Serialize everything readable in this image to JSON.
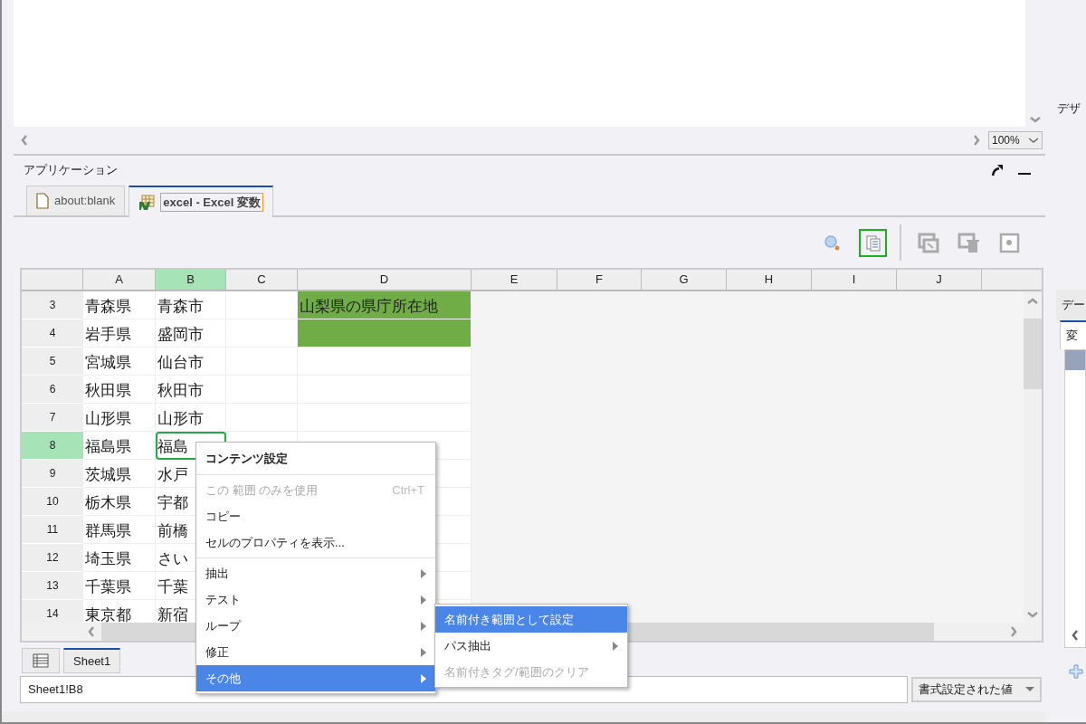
{
  "preview": {
    "zoom": "100%"
  },
  "side_panel": {
    "title": "デザ",
    "tab_header": "デー",
    "tab": "変"
  },
  "panel": {
    "title": "アプリケーション"
  },
  "tabs": [
    {
      "label": "about:blank",
      "kind": "page",
      "selected": false
    },
    {
      "label": "excel - Excel 変数",
      "kind": "sheet",
      "selected": true
    }
  ],
  "toolbar": [
    {
      "kind": "search",
      "on": false,
      "disabled": false
    },
    {
      "kind": "document",
      "on": true,
      "disabled": false
    },
    {
      "kind": "window-arrow",
      "on": false,
      "disabled": true
    },
    {
      "kind": "window-trash",
      "on": false,
      "disabled": true
    },
    {
      "kind": "window-search",
      "on": false,
      "disabled": true
    }
  ],
  "sheet": {
    "columns": [
      {
        "label": "A",
        "selected": false
      },
      {
        "label": "B",
        "selected": true
      },
      {
        "label": "C",
        "selected": false
      },
      {
        "label": "D",
        "selected": false
      },
      {
        "label": "E",
        "selected": false
      },
      {
        "label": "F",
        "selected": false
      },
      {
        "label": "G",
        "selected": false
      },
      {
        "label": "H",
        "selected": false
      },
      {
        "label": "I",
        "selected": false
      },
      {
        "label": "J",
        "selected": false
      }
    ],
    "rows": [
      {
        "number": "3",
        "selected": false,
        "a": "青森県",
        "b": "青森市",
        "d": "山梨県の県庁所在地",
        "d_filled": true
      },
      {
        "number": "4",
        "selected": false,
        "a": "岩手県",
        "b": "盛岡市",
        "d_filled": true
      },
      {
        "number": "5",
        "selected": false,
        "a": "宮城県",
        "b": "仙台市",
        "d_filled": false
      },
      {
        "number": "6",
        "selected": false,
        "a": "秋田県",
        "b": "秋田市",
        "d_filled": false
      },
      {
        "number": "7",
        "selected": false,
        "a": "山形県",
        "b": "山形市",
        "d_filled": false
      },
      {
        "number": "8",
        "selected": true,
        "a": "福島県",
        "b": "福島",
        "d_filled": false
      },
      {
        "number": "9",
        "selected": false,
        "a": "茨城県",
        "b": "水戸",
        "d_filled": false
      },
      {
        "number": "10",
        "selected": false,
        "a": "栃木県",
        "b": "宇都",
        "d_filled": false
      },
      {
        "number": "11",
        "selected": false,
        "a": "群馬県",
        "b": "前橋",
        "d_filled": false
      },
      {
        "number": "12",
        "selected": false,
        "a": "埼玉県",
        "b": "さい",
        "d_filled": false
      },
      {
        "number": "13",
        "selected": false,
        "a": "千葉県",
        "b": "千葉",
        "d_filled": false
      },
      {
        "number": "14",
        "selected": false,
        "a": "東京都",
        "b": "新宿",
        "d_filled": false
      }
    ]
  },
  "sheet_tabs": [
    {
      "label": "Sheet1",
      "selected": true
    }
  ],
  "name_box": {
    "value": "Sheet1!B8"
  },
  "value_mode": {
    "value": "書式設定された値"
  },
  "context_menu": {
    "items": [
      {
        "kind": "header",
        "label": "コンテンツ設定"
      },
      {
        "kind": "separator"
      },
      {
        "kind": "item",
        "label": "この 範囲 のみを使用",
        "shortcut": "Ctrl+T",
        "disabled": true,
        "selected": false,
        "submenu": false
      },
      {
        "kind": "item",
        "label": "コピー",
        "disabled": false,
        "selected": false,
        "submenu": false
      },
      {
        "kind": "item",
        "label": "セルのプロパティを表示...",
        "disabled": false,
        "selected": false,
        "submenu": false
      },
      {
        "kind": "separator"
      },
      {
        "kind": "item",
        "label": "抽出",
        "disabled": false,
        "selected": false,
        "submenu": true
      },
      {
        "kind": "item",
        "label": "テスト",
        "disabled": false,
        "selected": false,
        "submenu": true
      },
      {
        "kind": "item",
        "label": "ループ",
        "disabled": false,
        "selected": false,
        "submenu": true
      },
      {
        "kind": "item",
        "label": "修正",
        "disabled": false,
        "selected": false,
        "submenu": true
      },
      {
        "kind": "item",
        "label": "その他",
        "disabled": false,
        "selected": true,
        "submenu": true
      }
    ]
  },
  "submenu": {
    "items": [
      {
        "kind": "item",
        "label": "名前付き範囲として設定",
        "disabled": false,
        "selected": true,
        "submenu": false
      },
      {
        "kind": "item",
        "label": "パス抽出",
        "disabled": false,
        "selected": false,
        "submenu": true
      },
      {
        "kind": "item",
        "label": "名前付きタグ/範囲のクリア",
        "disabled": true,
        "selected": false,
        "submenu": false
      }
    ]
  }
}
